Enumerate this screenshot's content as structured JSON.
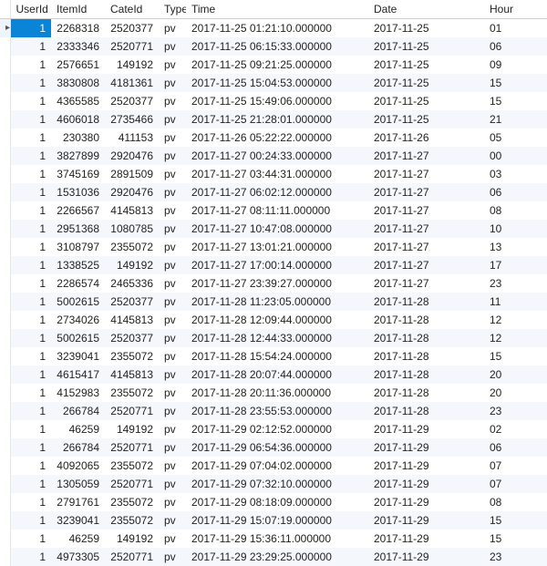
{
  "columns": {
    "user": "UserId",
    "item": "ItemId",
    "cate": "CateId",
    "type": "Type",
    "time": "Time",
    "date": "Date",
    "hour": "Hour"
  },
  "selected_row_index": 0,
  "row_indicator_glyph": "▸",
  "rows": [
    {
      "user": "1",
      "item": "2268318",
      "cate": "2520377",
      "type": "pv",
      "time": "2017-11-25 01:21:10.000000",
      "date": "2017-11-25",
      "hour": "01"
    },
    {
      "user": "1",
      "item": "2333346",
      "cate": "2520771",
      "type": "pv",
      "time": "2017-11-25 06:15:33.000000",
      "date": "2017-11-25",
      "hour": "06"
    },
    {
      "user": "1",
      "item": "2576651",
      "cate": "149192",
      "type": "pv",
      "time": "2017-11-25 09:21:25.000000",
      "date": "2017-11-25",
      "hour": "09"
    },
    {
      "user": "1",
      "item": "3830808",
      "cate": "4181361",
      "type": "pv",
      "time": "2017-11-25 15:04:53.000000",
      "date": "2017-11-25",
      "hour": "15"
    },
    {
      "user": "1",
      "item": "4365585",
      "cate": "2520377",
      "type": "pv",
      "time": "2017-11-25 15:49:06.000000",
      "date": "2017-11-25",
      "hour": "15"
    },
    {
      "user": "1",
      "item": "4606018",
      "cate": "2735466",
      "type": "pv",
      "time": "2017-11-25 21:28:01.000000",
      "date": "2017-11-25",
      "hour": "21"
    },
    {
      "user": "1",
      "item": "230380",
      "cate": "411153",
      "type": "pv",
      "time": "2017-11-26 05:22:22.000000",
      "date": "2017-11-26",
      "hour": "05"
    },
    {
      "user": "1",
      "item": "3827899",
      "cate": "2920476",
      "type": "pv",
      "time": "2017-11-27 00:24:33.000000",
      "date": "2017-11-27",
      "hour": "00"
    },
    {
      "user": "1",
      "item": "3745169",
      "cate": "2891509",
      "type": "pv",
      "time": "2017-11-27 03:44:31.000000",
      "date": "2017-11-27",
      "hour": "03"
    },
    {
      "user": "1",
      "item": "1531036",
      "cate": "2920476",
      "type": "pv",
      "time": "2017-11-27 06:02:12.000000",
      "date": "2017-11-27",
      "hour": "06"
    },
    {
      "user": "1",
      "item": "2266567",
      "cate": "4145813",
      "type": "pv",
      "time": "2017-11-27 08:11:11.000000",
      "date": "2017-11-27",
      "hour": "08"
    },
    {
      "user": "1",
      "item": "2951368",
      "cate": "1080785",
      "type": "pv",
      "time": "2017-11-27 10:47:08.000000",
      "date": "2017-11-27",
      "hour": "10"
    },
    {
      "user": "1",
      "item": "3108797",
      "cate": "2355072",
      "type": "pv",
      "time": "2017-11-27 13:01:21.000000",
      "date": "2017-11-27",
      "hour": "13"
    },
    {
      "user": "1",
      "item": "1338525",
      "cate": "149192",
      "type": "pv",
      "time": "2017-11-27 17:00:14.000000",
      "date": "2017-11-27",
      "hour": "17"
    },
    {
      "user": "1",
      "item": "2286574",
      "cate": "2465336",
      "type": "pv",
      "time": "2017-11-27 23:39:27.000000",
      "date": "2017-11-27",
      "hour": "23"
    },
    {
      "user": "1",
      "item": "5002615",
      "cate": "2520377",
      "type": "pv",
      "time": "2017-11-28 11:23:05.000000",
      "date": "2017-11-28",
      "hour": "11"
    },
    {
      "user": "1",
      "item": "2734026",
      "cate": "4145813",
      "type": "pv",
      "time": "2017-11-28 12:09:44.000000",
      "date": "2017-11-28",
      "hour": "12"
    },
    {
      "user": "1",
      "item": "5002615",
      "cate": "2520377",
      "type": "pv",
      "time": "2017-11-28 12:44:33.000000",
      "date": "2017-11-28",
      "hour": "12"
    },
    {
      "user": "1",
      "item": "3239041",
      "cate": "2355072",
      "type": "pv",
      "time": "2017-11-28 15:54:24.000000",
      "date": "2017-11-28",
      "hour": "15"
    },
    {
      "user": "1",
      "item": "4615417",
      "cate": "4145813",
      "type": "pv",
      "time": "2017-11-28 20:07:44.000000",
      "date": "2017-11-28",
      "hour": "20"
    },
    {
      "user": "1",
      "item": "4152983",
      "cate": "2355072",
      "type": "pv",
      "time": "2017-11-28 20:11:36.000000",
      "date": "2017-11-28",
      "hour": "20"
    },
    {
      "user": "1",
      "item": "266784",
      "cate": "2520771",
      "type": "pv",
      "time": "2017-11-28 23:55:53.000000",
      "date": "2017-11-28",
      "hour": "23"
    },
    {
      "user": "1",
      "item": "46259",
      "cate": "149192",
      "type": "pv",
      "time": "2017-11-29 02:12:52.000000",
      "date": "2017-11-29",
      "hour": "02"
    },
    {
      "user": "1",
      "item": "266784",
      "cate": "2520771",
      "type": "pv",
      "time": "2017-11-29 06:54:36.000000",
      "date": "2017-11-29",
      "hour": "06"
    },
    {
      "user": "1",
      "item": "4092065",
      "cate": "2355072",
      "type": "pv",
      "time": "2017-11-29 07:04:02.000000",
      "date": "2017-11-29",
      "hour": "07"
    },
    {
      "user": "1",
      "item": "1305059",
      "cate": "2520771",
      "type": "pv",
      "time": "2017-11-29 07:32:10.000000",
      "date": "2017-11-29",
      "hour": "07"
    },
    {
      "user": "1",
      "item": "2791761",
      "cate": "2355072",
      "type": "pv",
      "time": "2017-11-29 08:18:09.000000",
      "date": "2017-11-29",
      "hour": "08"
    },
    {
      "user": "1",
      "item": "3239041",
      "cate": "2355072",
      "type": "pv",
      "time": "2017-11-29 15:07:19.000000",
      "date": "2017-11-29",
      "hour": "15"
    },
    {
      "user": "1",
      "item": "46259",
      "cate": "149192",
      "type": "pv",
      "time": "2017-11-29 15:36:11.000000",
      "date": "2017-11-29",
      "hour": "15"
    },
    {
      "user": "1",
      "item": "4973305",
      "cate": "2520771",
      "type": "pv",
      "time": "2017-11-29 23:29:25.000000",
      "date": "2017-11-29",
      "hour": "23"
    }
  ]
}
